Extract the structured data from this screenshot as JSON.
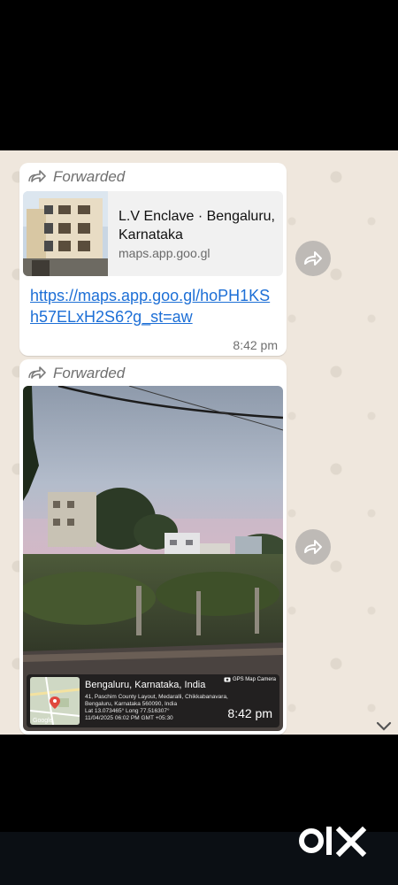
{
  "messages": [
    {
      "forwarded_label": "Forwarded",
      "preview": {
        "title": "L.V Enclave · Bengaluru, Karnataka",
        "domain": "maps.app.goo.gl"
      },
      "link": "https://maps.app.goo.gl/hoPH1KSh57ELxH2S6?g_st=aw",
      "time": "8:42 pm"
    },
    {
      "forwarded_label": "Forwarded",
      "photo_overlay": {
        "city": "Bengaluru, Karnataka, India",
        "address_lines": [
          "41, Paschim County Layout, Medaralli, Chikkabanavara,",
          "Bengaluru, Karnataka 560090, India",
          "Lat 13.073465° Long 77.516307°",
          "11/04/2025 06:02 PM GMT +05:30"
        ],
        "badge": "GPS Map Camera",
        "map_label": "Google"
      },
      "time": "8:42 pm"
    }
  ],
  "watermark": "olx",
  "colors": {
    "chat_background": "#efe7dd",
    "link": "#1d6fd6",
    "bubble": "#ffffff"
  }
}
